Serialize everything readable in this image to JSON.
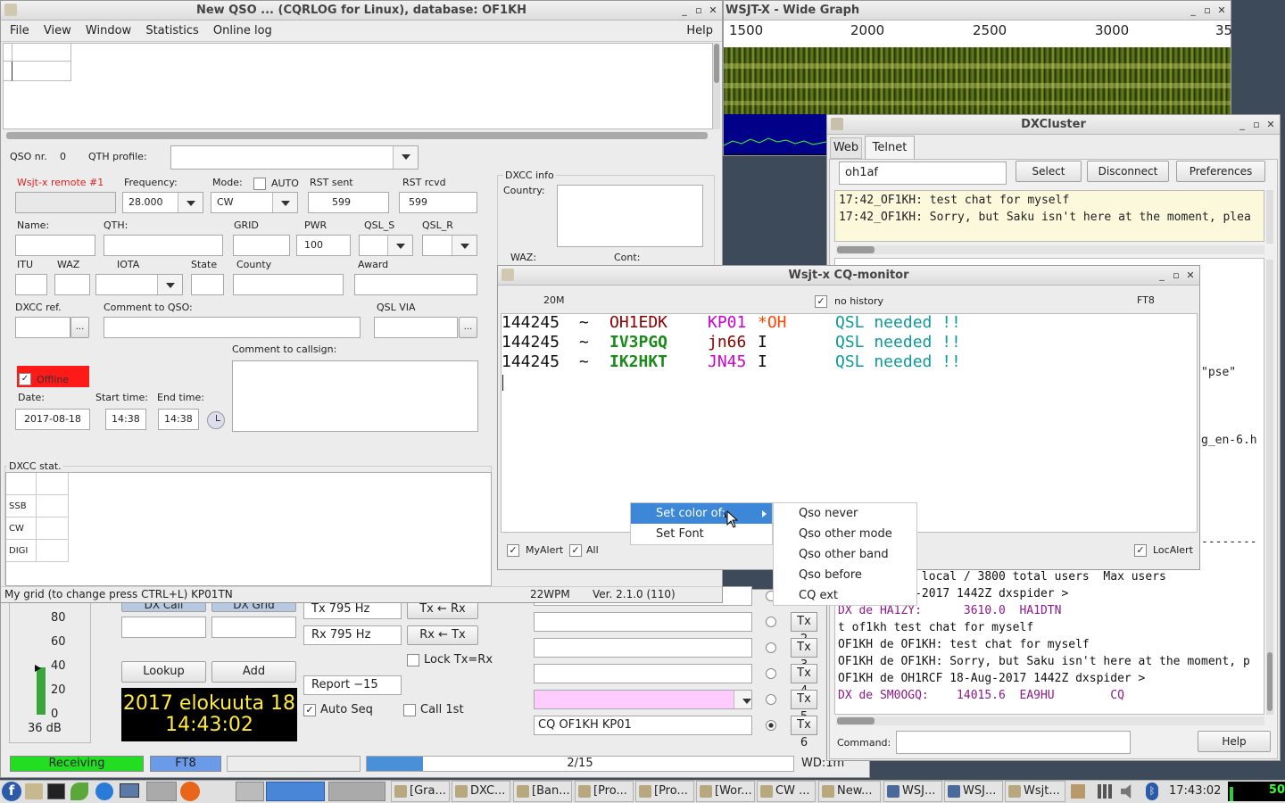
{
  "wallpaper_color": "#3d4a5a",
  "cqrlog": {
    "title": "New QSO ... (CQRLOG for Linux), database: OF1KH",
    "menu": [
      "File",
      "View",
      "Window",
      "Statistics",
      "Online log"
    ],
    "menu_help": "Help",
    "qso_nr_label": "QSO nr.",
    "qso_nr_value": "0",
    "qth_profile_label": "QTH profile:",
    "remote_label": "Wsjt-x remote #1",
    "frequency_label": "Frequency:",
    "frequency_value": "28.000",
    "mode_label": "Mode:",
    "mode_value": "CW",
    "auto_label": "AUTO",
    "rst_sent_label": "RST sent",
    "rst_sent_value": "599",
    "rst_rcvd_label": "RST rcvd",
    "rst_rcvd_value": "599",
    "name_label": "Name:",
    "qth_label": "QTH:",
    "grid_label": "GRID",
    "pwr_label": "PWR",
    "pwr_value": "100",
    "qsl_s_label": "QSL_S",
    "qsl_r_label": "QSL_R",
    "itu_label": "ITU",
    "waz_label": "WAZ",
    "iota_label": "IOTA",
    "state_label": "State",
    "county_label": "County",
    "award_label": "Award",
    "dxcc_ref_label": "DXCC ref.",
    "comment_qso_label": "Comment to QSO:",
    "qsl_via_label": "QSL VIA",
    "ellipsis": "...",
    "comment_call_label": "Comment to callsign:",
    "offline_label": "Offline",
    "date_label": "Date:",
    "date_value": "2017-08-18",
    "start_label": "Start time:",
    "start_value": "14:38",
    "end_label": "End time:",
    "end_value": "14:38",
    "dxcc_info_label": "DXCC info",
    "country_label": "Country:",
    "waz_info_label": "WAZ:",
    "cont_label": "Cont:",
    "dxcc_stat_label": "DXCC stat.",
    "stat_rows": [
      "SSB",
      "CW",
      "DIGI"
    ],
    "status_left": "My grid (to change press CTRL+L) KP01TN",
    "status_wpm": "22WPM",
    "status_ver": "Ver. 2.1.0 (110)"
  },
  "wide_graph": {
    "title": "WSJT-X - Wide Graph",
    "scale": [
      "1500",
      "2000",
      "2500",
      "3000",
      "35"
    ]
  },
  "dxcluster": {
    "title": "DXCluster",
    "tabs": [
      "Web",
      "Telnet"
    ],
    "callsign": "oh1af",
    "select": "Select",
    "disconnect": "Disconnect",
    "preferences": "Preferences",
    "chat_lines": [
      "17:42_OF1KH: test chat for myself",
      "17:42_OF1KH: Sorry, but Saku isn't here at the moment, plea"
    ],
    "frag_pse": "\"pse\"",
    "frag_en": "g_en-6.h",
    "dashes": "--------",
    "log_lines": [
      {
        "text": "0 nodes, 17 local / 3800 total users  Max users",
        "color": "#111"
      },
      {
        "text": "1RCF 18-Aug-2017 1442Z dxspider >",
        "color": "#111"
      },
      {
        "text": "DX de HA1ZY:      3610.0  HA1DTN",
        "color": "#8b1a8b"
      },
      {
        "text": "t of1kh test chat for myself",
        "color": "#111"
      },
      {
        "text": "OF1KH de OF1KH: test chat for myself",
        "color": "#111"
      },
      {
        "text": "OF1KH de OF1KH: Sorry, but Saku isn't here at the moment, p",
        "color": "#111"
      },
      {
        "text": "OF1KH de OH1RCF 18-Aug-2017 1442Z dxspider >",
        "color": "#111"
      },
      {
        "text": "DX de SM0OGQ:    14015.6  EA9HU        CQ",
        "color": "#8b1a8b"
      }
    ],
    "command_label": "Command:",
    "help": "Help"
  },
  "cq_monitor": {
    "title": "Wsjt-x CQ-monitor",
    "band": "20M",
    "no_history": "no history",
    "mode": "FT8",
    "rows": [
      {
        "time": "144245",
        "sep": "~",
        "call": "OH1EDK",
        "call_color": "#8b0000",
        "call_bold": false,
        "grid": "KP01",
        "grid_color": "#cc00cc",
        "grid_bold": false,
        "cont": "*OH",
        "cont_color": "#ff4500",
        "status": "QSL needed !!"
      },
      {
        "time": "144245",
        "sep": "~",
        "call": "IV3PGQ",
        "call_color": "#1a8a1a",
        "call_bold": true,
        "grid": "jn66",
        "grid_color": "#8b0000",
        "grid_bold": false,
        "grid2": "66",
        "cont": "I",
        "cont_color": "#111",
        "status": "QSL needed !!"
      },
      {
        "time": "144245",
        "sep": "~",
        "call": "IK2HKT",
        "call_color": "#1a8a1a",
        "call_bold": true,
        "grid": "JN45",
        "grid_color": "#cc00cc",
        "grid_bold": false,
        "cont": "I",
        "cont_color": "#111",
        "status": "QSL needed !!"
      }
    ],
    "status_color": "#0e9a9a",
    "myalert": "MyAlert",
    "all": "All",
    "localert": "LocAlert"
  },
  "context_menu": {
    "items": [
      "Set color of:",
      "Set Font"
    ],
    "submenu": [
      "Qso never",
      "Qso other mode",
      "Qso other band",
      "Qso before",
      "CQ ext"
    ]
  },
  "wsjtx_main": {
    "meter": [
      "80",
      "60",
      "40",
      "20",
      "0"
    ],
    "db": "36 dB",
    "dx_call": "DX Call",
    "dx_grid": "DX Grid",
    "lookup": "Lookup",
    "add": "Add",
    "clock_date": "2017 elokuuta 18",
    "clock_time": "14:43:02",
    "tx_freq": "Tx  795  Hz",
    "rx_freq": "Rx  795  Hz",
    "tx_rx": "Tx ← Rx",
    "rx_tx": "Rx ← Tx",
    "lock": "Lock Tx=Rx",
    "report": "Report −15",
    "auto_seq": "Auto Seq",
    "call_1st": "Call 1st",
    "tx_buttons": [
      "Tx 2",
      "Tx 3",
      "Tx 4",
      "Tx 5",
      "Tx 6"
    ],
    "tx6_msg": "CQ OF1KH KP01",
    "receiving": "Receiving",
    "mode": "FT8",
    "progress": "2/15",
    "wd": "WD:1m"
  },
  "taskbar": {
    "items": [
      "[Gra...",
      "DXC...",
      "[Ban...",
      "[Pro...",
      "[Pro...",
      "[Wor...",
      "CW ...",
      "New...",
      "WSJ...",
      "WSJ...",
      "Wsjt..."
    ],
    "clock": "17:43:02",
    "cpu": "50"
  }
}
